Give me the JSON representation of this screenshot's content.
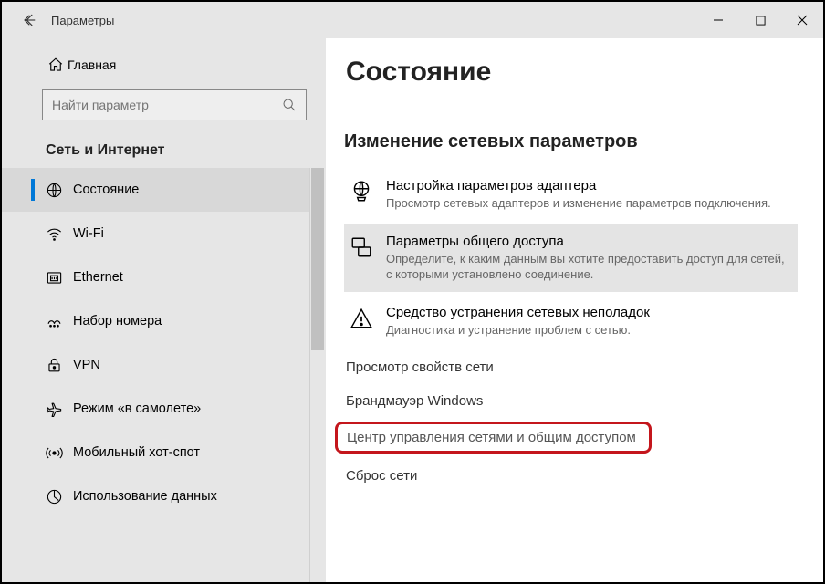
{
  "window": {
    "title": "Параметры"
  },
  "sidebar": {
    "home": "Главная",
    "search_placeholder": "Найти параметр",
    "category": "Сеть и Интернет",
    "items": [
      {
        "label": "Состояние"
      },
      {
        "label": "Wi-Fi"
      },
      {
        "label": "Ethernet"
      },
      {
        "label": "Набор номера"
      },
      {
        "label": "VPN"
      },
      {
        "label": "Режим «в самолете»"
      },
      {
        "label": "Мобильный хот-спот"
      },
      {
        "label": "Использование данных"
      }
    ]
  },
  "main": {
    "page_title": "Состояние",
    "section_title": "Изменение сетевых параметров",
    "rows": [
      {
        "title": "Настройка параметров адаптера",
        "desc": "Просмотр сетевых адаптеров и изменение параметров подключения."
      },
      {
        "title": "Параметры общего доступа",
        "desc": "Определите, к каким данным вы хотите предоставить доступ для сетей, с которыми установлено соединение."
      },
      {
        "title": "Средство устранения сетевых неполадок",
        "desc": "Диагностика и устранение проблем с сетью."
      }
    ],
    "links": {
      "view_props": "Просмотр свойств сети",
      "firewall": "Брандмауэр Windows",
      "network_center": "Центр управления сетями и общим доступом",
      "reset": "Сброс сети"
    }
  }
}
